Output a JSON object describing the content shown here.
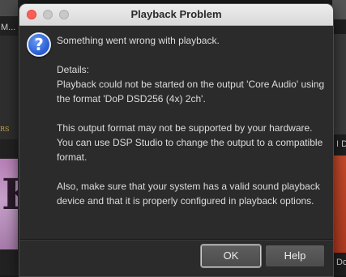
{
  "background": {
    "left_text": "M...",
    "left_tile_tag": "RS",
    "left_tile_big": "K",
    "right_text_1": "I D",
    "right_text_2": "Do"
  },
  "dialog": {
    "title": "Playback Problem",
    "icon": "question-icon",
    "icon_glyph": "?",
    "paragraphs": [
      "Something went wrong with playback.",
      "Details:\nPlayback could not be started on the output 'Core Audio' using the format 'DoP DSD256 (4x) 2ch'.",
      "This output format may not be supported by your hardware.\n  You can use DSP Studio to change the output to a compatible format.",
      "Also, make sure that your system has a valid sound playback device and that it is properly configured in playback options."
    ],
    "buttons": {
      "ok": "OK",
      "help": "Help"
    }
  },
  "colors": {
    "dialog_bg": "#2b2b2b",
    "titlebar": "#e3e3e3",
    "close_button": "#ff5f57",
    "icon_blue": "#2f62d6",
    "text": "#dcdcdc"
  }
}
